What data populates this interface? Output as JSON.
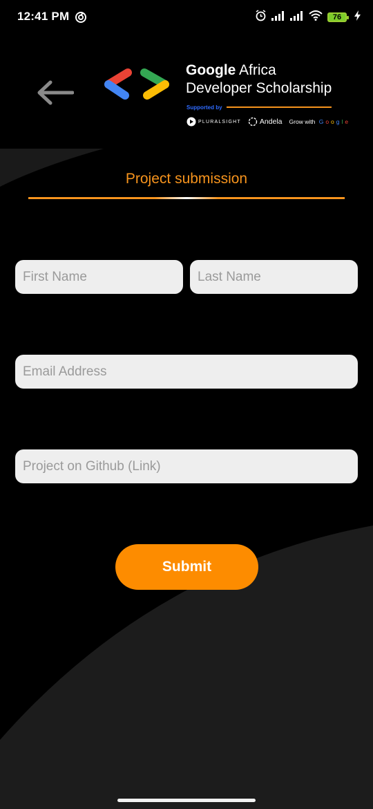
{
  "status_bar": {
    "time": "12:41 PM",
    "battery": "76",
    "icons": [
      "sync-icon",
      "alarm-icon",
      "signal-icon",
      "signal-icon",
      "wifi-icon",
      "battery-icon",
      "charging-icon"
    ]
  },
  "header": {
    "back_icon": "arrow-left-icon",
    "brand_line1_bold": "Google",
    "brand_line1_rest": " Africa",
    "brand_line2": "Developer Scholarship",
    "supported_by": "Supported by",
    "sponsors": {
      "pluralsight": "PLURALSIGHT",
      "andela": "Andela",
      "grow_prefix": "Grow with ",
      "grow_google": [
        "G",
        "o",
        "o",
        "g",
        "l",
        "e"
      ]
    }
  },
  "form": {
    "title": "Project submission",
    "first_name_placeholder": "First Name",
    "last_name_placeholder": "Last Name",
    "email_placeholder": "Email Address",
    "github_placeholder": "Project on Github (Link)",
    "submit_label": "Submit"
  },
  "colors": {
    "accent": "#f7941d",
    "button": "#fd8c00",
    "background": "#000000",
    "field": "#eeeeee"
  }
}
